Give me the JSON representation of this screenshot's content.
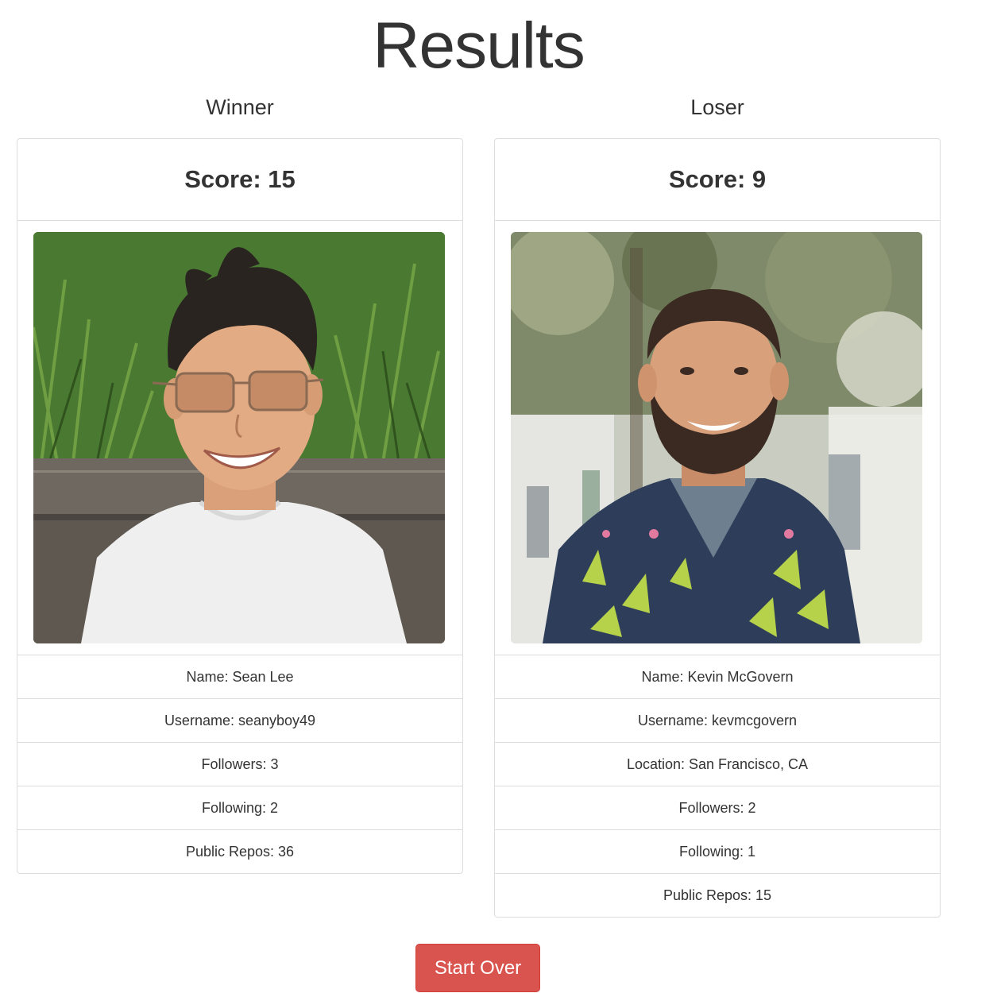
{
  "page": {
    "title": "Results"
  },
  "winner": {
    "label": "Winner",
    "score": "Score: 15",
    "photo_alt": "avatar",
    "info": [
      "Name: Sean Lee",
      "Username: seanyboy49",
      "Followers: 3",
      "Following: 2",
      "Public Repos: 36"
    ]
  },
  "loser": {
    "label": "Loser",
    "score": "Score: 9",
    "photo_alt": "avatar",
    "info": [
      "Name: Kevin McGovern",
      "Username: kevmcgovern",
      "Location: San Francisco, CA",
      "Followers: 2",
      "Following: 1",
      "Public Repos: 15"
    ]
  },
  "actions": {
    "start_over_label": "Start Over"
  },
  "colors": {
    "danger_button": "#d9534f",
    "border": "#dddddd",
    "text": "#333333"
  }
}
